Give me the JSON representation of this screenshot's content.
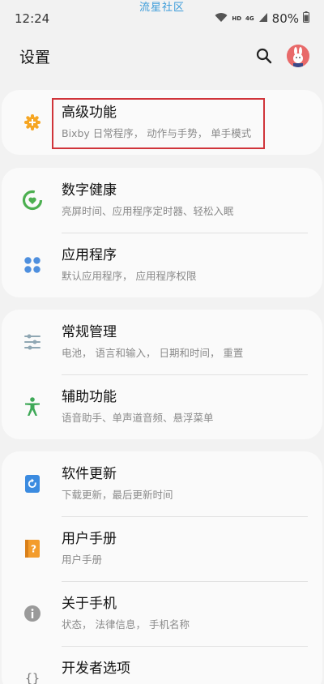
{
  "watermark": "流星社区",
  "status": {
    "time": "12:24",
    "hd": "HD",
    "network": "4G",
    "battery": "80%"
  },
  "header": {
    "title": "设置"
  },
  "cards": [
    {
      "items": [
        {
          "title": "高级功能",
          "subtitle": "Bixby 日常程序， 动作与手势， 单手模式",
          "icon": "plus-gear-icon",
          "color": "#f6a623"
        }
      ]
    },
    {
      "items": [
        {
          "title": "数字健康",
          "subtitle": "亮屏时间、应用程序定时器、轻松入眠",
          "icon": "digital-wellbeing-icon",
          "color": "#4caf50"
        },
        {
          "title": "应用程序",
          "subtitle": "默认应用程序， 应用程序权限",
          "icon": "apps-grid-icon",
          "color": "#4e8fde"
        }
      ]
    },
    {
      "items": [
        {
          "title": "常规管理",
          "subtitle": "电池， 语言和输入， 日期和时间， 重置",
          "icon": "sliders-icon",
          "color": "#8fa7b3"
        },
        {
          "title": "辅助功能",
          "subtitle": "语音助手、单声道音频、悬浮菜单",
          "icon": "accessibility-icon",
          "color": "#3ea857"
        }
      ]
    },
    {
      "items": [
        {
          "title": "软件更新",
          "subtitle": "下载更新，最后更新时间",
          "icon": "software-update-icon",
          "color": "#3b8be0"
        },
        {
          "title": "用户手册",
          "subtitle": "用户手册",
          "icon": "user-manual-icon",
          "color": "#f39c2c"
        },
        {
          "title": "关于手机",
          "subtitle": "状态， 法律信息， 手机名称",
          "icon": "info-icon",
          "color": "#9a9a9a"
        },
        {
          "title": "开发者选项",
          "subtitle": "",
          "icon": "developer-braces-icon",
          "color": "#777777"
        }
      ]
    }
  ]
}
